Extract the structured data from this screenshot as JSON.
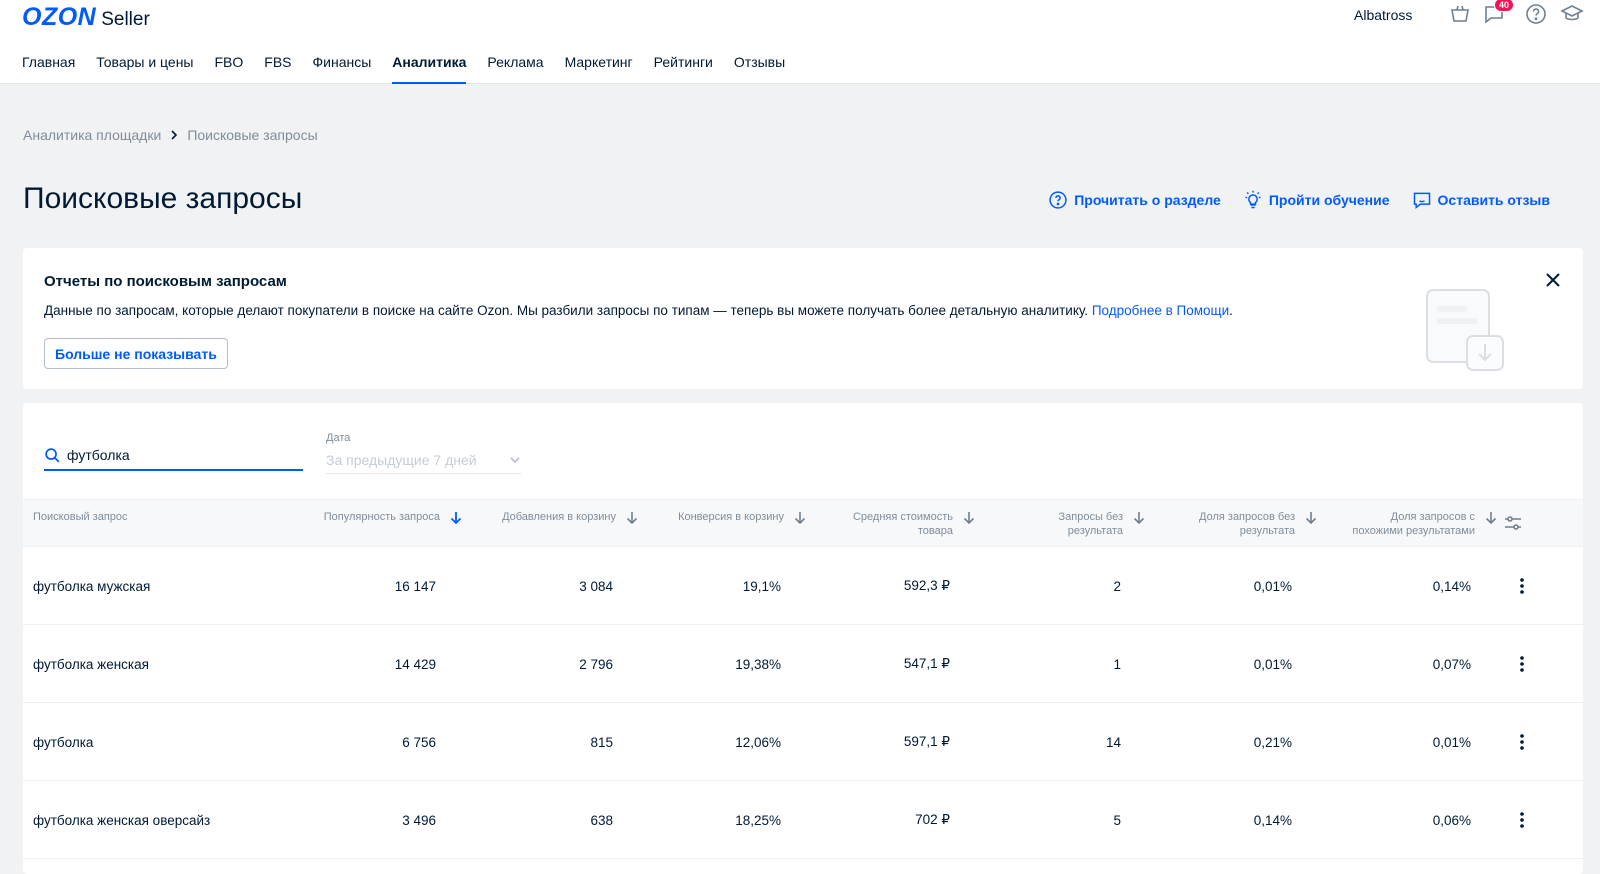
{
  "header": {
    "logo_brand": "OZON",
    "logo_product": "Seller",
    "account": "Albatross",
    "messages_badge": "40",
    "nav": [
      {
        "label": "Главная",
        "active": false
      },
      {
        "label": "Товары и цены",
        "active": false
      },
      {
        "label": "FBO",
        "active": false
      },
      {
        "label": "FBS",
        "active": false
      },
      {
        "label": "Финансы",
        "active": false
      },
      {
        "label": "Аналитика",
        "active": true
      },
      {
        "label": "Реклама",
        "active": false
      },
      {
        "label": "Маркетинг",
        "active": false
      },
      {
        "label": "Рейтинги",
        "active": false
      },
      {
        "label": "Отзывы",
        "active": false
      }
    ]
  },
  "breadcrumb": {
    "parent": "Аналитика площадки",
    "current": "Поисковые запросы"
  },
  "page": {
    "title": "Поисковые запросы",
    "actions": {
      "read": "Прочитать о разделе",
      "training": "Пройти обучение",
      "feedback": "Оставить отзыв"
    }
  },
  "info_card": {
    "title": "Отчеты по поисковым запросам",
    "text": "Данные по запросам, которые делают покупатели в поиске на сайте Ozon. Мы разбили запросы по типам — теперь вы можете получать более детальную аналитику.",
    "link": "Подробнее в Помощи",
    "link_suffix": ".",
    "button": "Больше не показывать"
  },
  "filters": {
    "search_value": "футболка",
    "date_label": "Дата",
    "date_value": "За предыдущие 7 дней"
  },
  "table": {
    "columns": [
      {
        "line1": "Поисковый запрос",
        "line2": ""
      },
      {
        "line1": "Популярность запроса",
        "line2": ""
      },
      {
        "line1": "Добавления в корзину",
        "line2": ""
      },
      {
        "line1": "Конверсия в корзину",
        "line2": ""
      },
      {
        "line1": "Средняя стоимость",
        "line2": "товара"
      },
      {
        "line1": "Запросы без",
        "line2": "результата"
      },
      {
        "line1": "Доля запросов без",
        "line2": "результата"
      },
      {
        "line1": "Доля запросов с",
        "line2": "похожими результатами"
      }
    ],
    "rows": [
      {
        "query": "футболка мужская",
        "popularity": "16 147",
        "cart_adds": "3 084",
        "conversion": "19,1%",
        "avg_price": "592,3 ₽",
        "no_result": "2",
        "no_result_share": "0,01%",
        "similar_share": "0,14%"
      },
      {
        "query": "футболка женская",
        "popularity": "14 429",
        "cart_adds": "2 796",
        "conversion": "19,38%",
        "avg_price": "547,1 ₽",
        "no_result": "1",
        "no_result_share": "0,01%",
        "similar_share": "0,07%"
      },
      {
        "query": "футболка",
        "popularity": "6 756",
        "cart_adds": "815",
        "conversion": "12,06%",
        "avg_price": "597,1 ₽",
        "no_result": "14",
        "no_result_share": "0,21%",
        "similar_share": "0,01%"
      },
      {
        "query": "футболка женская оверсайз",
        "popularity": "3 496",
        "cart_adds": "638",
        "conversion": "18,25%",
        "avg_price": "702 ₽",
        "no_result": "5",
        "no_result_share": "0,14%",
        "similar_share": "0,06%"
      }
    ]
  },
  "colors": {
    "brand": "#005bff",
    "text": "#001a34",
    "muted": "#808d9a",
    "background": "#f1f2f4",
    "badge": "#f91155"
  }
}
